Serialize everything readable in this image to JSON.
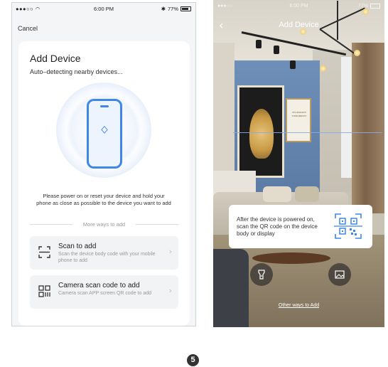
{
  "left": {
    "status": {
      "signal": "●●●○○",
      "time": "6:00 PM",
      "battery": "77%"
    },
    "cancel": "Cancel",
    "title": "Add Device",
    "subtitle": "Auto–detecting nearby devices...",
    "instructions": "Please power on or reset your device and hold your phone as close as possible to the device you want to add",
    "more_ways": "More ways to add",
    "options": [
      {
        "title": "Scan to add",
        "desc": "Scan the device body code with your mobile phone to add"
      },
      {
        "title": "Camera scan code to add",
        "desc": "Camera scan APP screen QR code to add"
      }
    ]
  },
  "right": {
    "status": {
      "signal": "●●●○○",
      "time": "6:00 PM",
      "battery": "77%"
    },
    "title": "Add Device",
    "tip": "After the device is powered on, scan the QR code on the device body or display",
    "other_ways": "Other ways to Add",
    "painting_text": "TESTIMONY TOMORROW"
  },
  "step_number": "5",
  "colors": {
    "accent": "#3f86e5",
    "card_bg": "#ffffff",
    "option_bg": "#f2f3f5"
  },
  "icons": [
    "bluetooth-icon",
    "scan-icon",
    "qr-scan-icon",
    "chevron-right-icon",
    "back-icon",
    "flashlight-icon",
    "gallery-icon",
    "wifi-icon"
  ]
}
